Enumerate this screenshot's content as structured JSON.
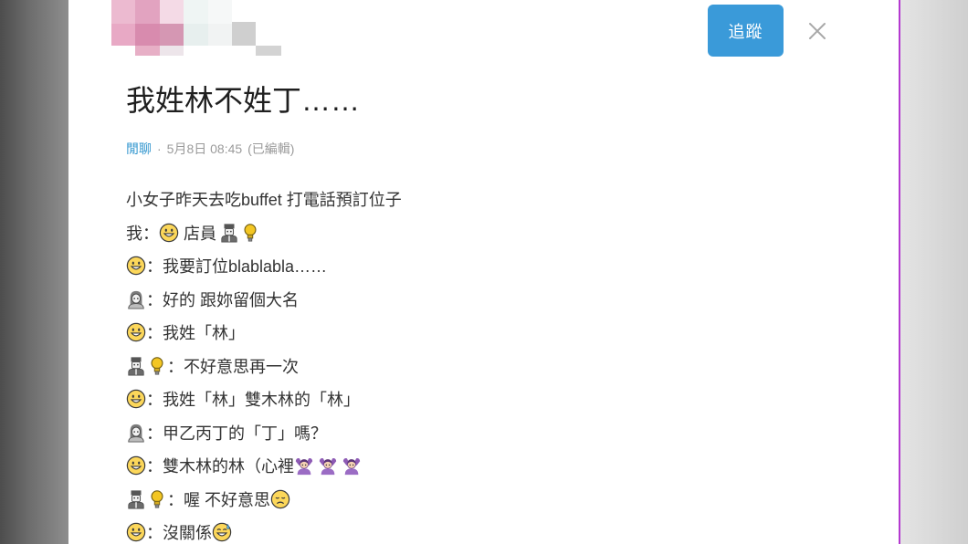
{
  "header": {
    "follow_label": "追蹤"
  },
  "post": {
    "title": "我姓林不姓丁……",
    "category": "閒聊",
    "separator": "·",
    "date": "5月8日 08:45",
    "edited": "(已編輯)"
  },
  "colors": {
    "accent": "#3a9ad9",
    "category": "#3397cf",
    "meta_text": "#9b9b9b",
    "body_text": "#333333",
    "divider": "#b43ad0"
  },
  "body": {
    "lines": [
      {
        "segments": [
          {
            "text": "小女子昨天去吃buffet 打電話預訂位子"
          }
        ]
      },
      {
        "segments": [
          {
            "text": "我："
          },
          {
            "icon": "smile-face-icon"
          },
          {
            "text": " 店員"
          },
          {
            "icon": "clerk-icon"
          },
          {
            "icon": "bulb-icon"
          }
        ]
      },
      {
        "segments": [
          {
            "icon": "smile-face-icon"
          },
          {
            "text": "：我要訂位blablabla……"
          }
        ]
      },
      {
        "segments": [
          {
            "icon": "woman-icon"
          },
          {
            "text": "：好的 跟妳留個大名"
          }
        ]
      },
      {
        "segments": [
          {
            "icon": "smile-face-icon"
          },
          {
            "text": "：我姓「林」"
          }
        ]
      },
      {
        "segments": [
          {
            "icon": "clerk-icon"
          },
          {
            "icon": "bulb-icon"
          },
          {
            "text": "：不好意思再一次"
          }
        ]
      },
      {
        "segments": [
          {
            "icon": "smile-face-icon"
          },
          {
            "text": "：我姓「林」雙木林的「林」"
          }
        ]
      },
      {
        "segments": [
          {
            "icon": "woman-icon"
          },
          {
            "text": "：甲乙丙丁的「丁」嗎？"
          }
        ]
      },
      {
        "segments": [
          {
            "icon": "smile-face-icon"
          },
          {
            "text": "：雙木林的林（心裡"
          },
          {
            "icon": "gesture-person-icon"
          },
          {
            "icon": "gesture-person-icon"
          },
          {
            "icon": "gesture-person-icon"
          }
        ]
      },
      {
        "segments": [
          {
            "icon": "clerk-icon"
          },
          {
            "icon": "bulb-icon"
          },
          {
            "text": "：喔 不好意思"
          },
          {
            "icon": "disappointed-face-icon"
          }
        ]
      },
      {
        "segments": [
          {
            "icon": "smile-face-icon"
          },
          {
            "text": "：沒關係"
          },
          {
            "icon": "sweat-smile-icon"
          }
        ]
      }
    ]
  }
}
